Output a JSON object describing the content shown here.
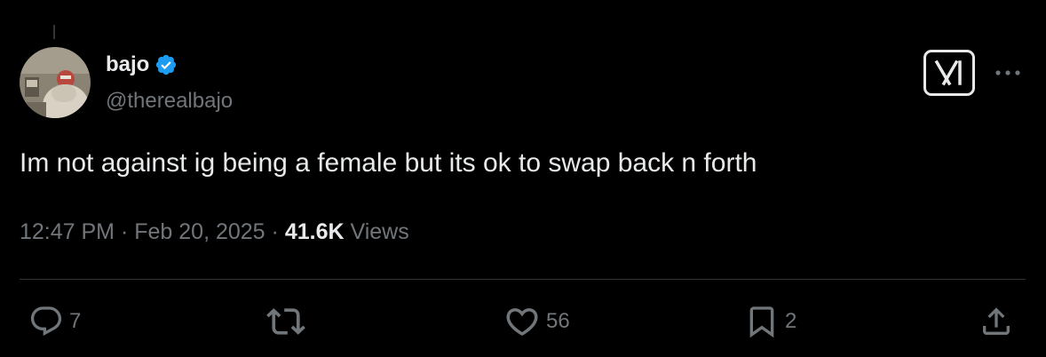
{
  "user": {
    "display_name": "bajo",
    "handle": "@therealbajo",
    "verified_color": "#1d9bf0",
    "avatar_icon": "profile-photo"
  },
  "header": {
    "grok_icon": "grok-icon",
    "more_icon": "more-dots-icon"
  },
  "tweet": {
    "text": "Im not against ig being a female but its ok to swap back n forth",
    "time": "12:47 PM",
    "separator": "·",
    "date": "Feb 20, 2025",
    "views_count": "41.6K",
    "views_label": "Views"
  },
  "actions": {
    "reply_count": "7",
    "repost_count": "",
    "like_count": "56",
    "bookmark_count": "2"
  },
  "colors": {
    "background": "#000000",
    "text": "#e7e9ea",
    "muted": "#71767b",
    "divider": "#2f3336"
  }
}
